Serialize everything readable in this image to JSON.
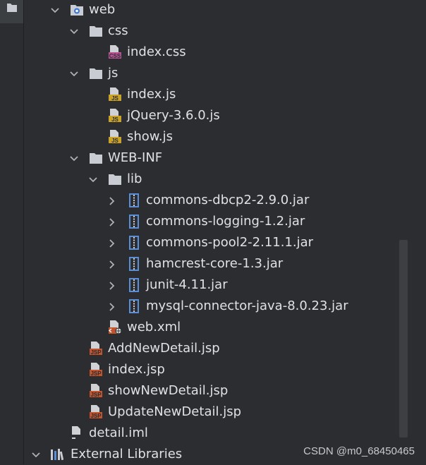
{
  "tree": [
    {
      "label": "web",
      "type": "web-folder",
      "depth": 0,
      "chevron": "down"
    },
    {
      "label": "css",
      "type": "folder",
      "depth": 1,
      "chevron": "down"
    },
    {
      "label": "index.css",
      "type": "css",
      "depth": 2,
      "chevron": ""
    },
    {
      "label": "js",
      "type": "folder",
      "depth": 1,
      "chevron": "down"
    },
    {
      "label": "index.js",
      "type": "js",
      "depth": 2,
      "chevron": ""
    },
    {
      "label": "jQuery-3.6.0.js",
      "type": "js",
      "depth": 2,
      "chevron": ""
    },
    {
      "label": "show.js",
      "type": "js",
      "depth": 2,
      "chevron": ""
    },
    {
      "label": "WEB-INF",
      "type": "folder",
      "depth": 1,
      "chevron": "down"
    },
    {
      "label": "lib",
      "type": "folder",
      "depth": 2,
      "chevron": "down"
    },
    {
      "label": "commons-dbcp2-2.9.0.jar",
      "type": "jar",
      "depth": 3,
      "chevron": "right"
    },
    {
      "label": "commons-logging-1.2.jar",
      "type": "jar",
      "depth": 3,
      "chevron": "right"
    },
    {
      "label": "commons-pool2-2.11.1.jar",
      "type": "jar",
      "depth": 3,
      "chevron": "right"
    },
    {
      "label": "hamcrest-core-1.3.jar",
      "type": "jar",
      "depth": 3,
      "chevron": "right"
    },
    {
      "label": "junit-4.11.jar",
      "type": "jar",
      "depth": 3,
      "chevron": "right"
    },
    {
      "label": "mysql-connector-java-8.0.23.jar",
      "type": "jar",
      "depth": 3,
      "chevron": "right"
    },
    {
      "label": "web.xml",
      "type": "xml",
      "depth": 2,
      "chevron": ""
    },
    {
      "label": "AddNewDetail.jsp",
      "type": "jsp",
      "depth": 1,
      "chevron": ""
    },
    {
      "label": "index.jsp",
      "type": "jsp",
      "depth": 1,
      "chevron": ""
    },
    {
      "label": "showNewDetail.jsp",
      "type": "jsp",
      "depth": 1,
      "chevron": ""
    },
    {
      "label": "UpdateNewDetail.jsp",
      "type": "jsp",
      "depth": 1,
      "chevron": ""
    },
    {
      "label": "detail.iml",
      "type": "iml",
      "depth": 0,
      "chevron": ""
    },
    {
      "label": "External Libraries",
      "type": "libraries",
      "depth": -1,
      "chevron": "down"
    }
  ],
  "icon_text": {
    "css": "CSS",
    "js": "JS",
    "jsp": "JSP"
  },
  "watermark": "CSDN @m0_68450465",
  "colors": {
    "folder": "#c9ccd2",
    "css_badge": "#b85495",
    "js_badge": "#c9a227",
    "jsp_badge": "#c1542d",
    "jar": "#5a8fd8",
    "selected": "#2e436e"
  }
}
